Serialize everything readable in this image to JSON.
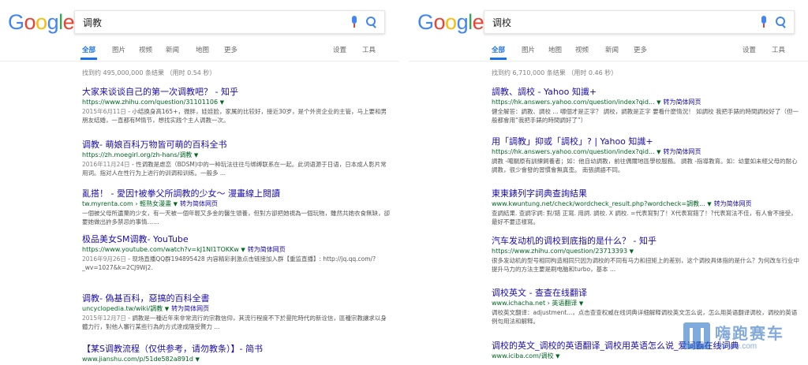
{
  "left": {
    "logo": [
      "G",
      "o",
      "o",
      "g",
      "l",
      "e"
    ],
    "query": "调教",
    "tabs": [
      "全部",
      "图片",
      "视频",
      "新闻",
      "地图",
      "更多",
      "设置",
      "工具"
    ],
    "stats": "找到约 495,000,000 条结果 （用时 0.54 秒）",
    "results": [
      {
        "title": "大家来谈谈自己的第一次调教吧？ - 知乎",
        "url": "https://www.zhihu.com/question/31101106",
        "translate": "",
        "date": "2015年6月11日",
        "snippet": " - 小结换身高165+，微胖，娃娃脸，家属的比较好，接近30岁，是个外资企业的主管，马上要和男朋友结婚，一直都有M情节，想找实践个主人调教一次。"
      },
      {
        "title": "调教- 萌娘百科万物皆可萌的百科全书",
        "url": "https://zh.moegirl.org/zh-hans/调教",
        "translate": "",
        "date": "2016年11月24日",
        "snippet": " - 性调教是虐恋（BDSM)中的一种玩法往往与绑缚联系在一起。此词语源于日语，日本成人影片常用词。指对人在性行为上进行的训调和训练。一般多 ..."
      },
      {
        "title": "亂搭！ - 愛因†被拳父所調教的少女～ 漫畫線上閱讀",
        "url": "tw.myrenta.com › 輕熟女漫畫",
        "translate": "转为简体网页",
        "date": "",
        "snippet": "一個被父母所遺棄的少女，有一天被一個年輕又多金的醫生領養，但對方卻把她視為一個玩物，雖然共她衣食無缺，卻要她做出許多禁忌的事情……"
      },
      {
        "title": "极品美女SM调教- YouTube",
        "url": "https://www.youtube.com/watch?v=kJ1NI1TOKKw",
        "translate": "转为简体网页",
        "date": "2016年9月26日",
        "snippet": " - 现场直播QQ群194895428 内容精彩刺激点击链接加入群【重监直播】: http://jq.qq.com/?_wv=1027&k=2CJ9Wj2."
      },
      {
        "title": "调教- 偽基百科，惡搞的百科全書",
        "url": "uncyclopedia.tw/wiki/調教",
        "translate": "转为简体网页",
        "date": "2015年12月7日",
        "snippet": " - 調教是一種近年來非常流行的宗教信仰，其流行程度不下於曼陀時代的新诠信，區種宗教讓求以身體力行，對他人審行某些行為的方式達成隨受賢力 ..."
      },
      {
        "title": "【某S调教流程（仅供参考，请勿教条）】- 简书",
        "url": "www.jianshu.com/p/51de582a891d",
        "translate": "",
        "date": "",
        "snippet": ""
      }
    ]
  },
  "right": {
    "logo": [
      "G",
      "o",
      "o",
      "g",
      "l",
      "e"
    ],
    "query": "调校",
    "tabs": [
      "全部",
      "图片",
      "地图",
      "视频",
      "新闻",
      "更多",
      "设置",
      "工具"
    ],
    "stats": "找到约 6,710,000 条结果 （用时 0.46 秒）",
    "results": [
      {
        "title": "調教、調校 - Yahoo 知識+",
        "url": "https://hk.answers.yahoo.com/question/index?qid...",
        "translate": "转为简体网页",
        "date": "",
        "snippet": "健全解答：調教、調校 ... 哪個才是正字？ 調校，調教是正字 要看什麼情況！ 如調校 我把手錶的時間調校好了（但一般都會用“我把手錶的時間調好了”）"
      },
      {
        "title": "用「調教」抑或「調校」? | Yahoo 知識+",
        "url": "https://hk.answers.yahoo.com/question/index?qid...",
        "translate": "转为简体网页",
        "date": "",
        "snippet": "調教 -噶關原有訓練飼養者；如：他自幼調教，前往偶爾地區學校服務。 調教 -指導教育。如：幼童如未經父母的耐心調教，很少會發的習慣會無真歪。 南張調語不同。"
      },
      {
        "title": "東東錶列字詞典查詢結果",
        "url": "www.kwuntung.net/check/wordcheck_result.php?wordcheck=調教...",
        "translate": "转为简体网页",
        "date": "",
        "snippet": "查調結果. 查調字詞: 對/錯 正寫. 用詞. 調校. X 調校. =代表寫對了！X代表寫錯了！?代表寫法不佳，有人會不接受，最好不要這樣寫。"
      },
      {
        "title": "汽车发动机的调校到底指的是什么？ - 知乎",
        "url": "https://www.zhihu.com/question/23713393",
        "translate": "",
        "date": "",
        "snippet": "很多发动机的型号相同构造相同只因为调校的不同有马力和扭矩上的差别，这个调校具体指的是什么？为何改车行业中提升马力的方法主要是刷电脑和turbo，基本 ..."
      },
      {
        "title": "调校英文 - 查查在线翻译",
        "url": "www.ichacha.net › 英语翻译",
        "translate": "",
        "date": "",
        "snippet": "调校英文翻译：adjustment...，点击查查权威在线词典详细解释调校英文怎么说，怎么用英语翻译调校，调校的英语例句用法和解释。"
      },
      {
        "title": "调校的英文_调校的英语翻译_调校用英语怎么说_爱词霸在线词典",
        "url": "www.iciba.com/调校",
        "translate": "",
        "date": "",
        "snippet": ""
      }
    ]
  },
  "watermark": {
    "main": "嗨跑赛车",
    "sub": "HiPole.com"
  }
}
